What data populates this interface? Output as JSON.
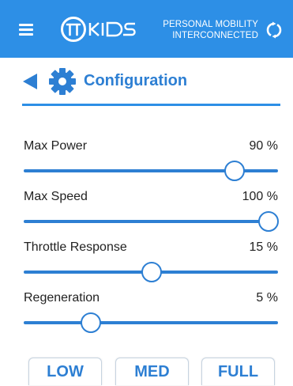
{
  "header": {
    "brand_line1": "PERSONAL MOBILITY",
    "brand_line2": "INTERCONNECTED",
    "menu_icon": "hamburger-menu-icon",
    "logo_icon": "tt-kids-logo",
    "sync_icon": "sync-icon",
    "background_color": "#2d8fe6"
  },
  "title_bar": {
    "back_icon": "back-arrow-icon",
    "gear_icon": "gear-icon",
    "title": "Configuration",
    "accent_color": "#2d7fd3"
  },
  "settings": [
    {
      "label": "Max Power",
      "value_text": "90 %",
      "level": 0.86
    },
    {
      "label": "Max Speed",
      "value_text": "100 %",
      "level": 1.0
    },
    {
      "label": "Throttle Response",
      "value_text": "15 %",
      "level": 0.52
    },
    {
      "label": "Regeneration",
      "value_text": "5 %",
      "level": 0.27
    }
  ],
  "presets": {
    "low_label": "LOW",
    "med_label": "MED",
    "full_label": "FULL"
  }
}
